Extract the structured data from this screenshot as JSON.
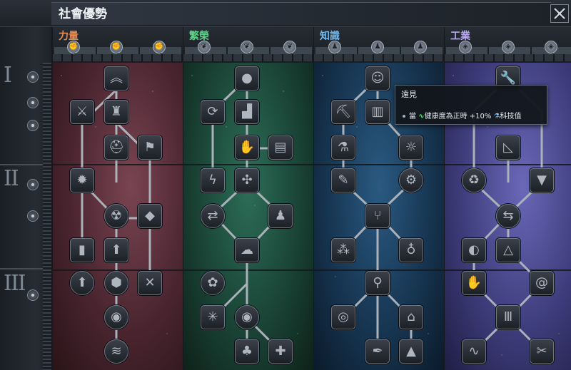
{
  "window": {
    "title": "社會優勢",
    "close_icon": "close-icon"
  },
  "tiers": [
    {
      "label": "I"
    },
    {
      "label": "II"
    },
    {
      "label": "III"
    }
  ],
  "columns": [
    {
      "name": "力量",
      "color": "#e88a4e",
      "sub_icons": [
        "fist-icon",
        "fist-icon",
        "fist-icon"
      ]
    },
    {
      "name": "繁榮",
      "color": "#5fd08a",
      "sub_icons": [
        "leaf-icon",
        "leaf-icon",
        "leaf-icon"
      ]
    },
    {
      "name": "知識",
      "color": "#6fb8ec",
      "sub_icons": [
        "person-icon",
        "person-icon",
        "person-icon"
      ]
    },
    {
      "name": "工業",
      "color": "#b9a8ef",
      "sub_icons": [
        "cube-icon",
        "cube-icon",
        "cube-icon"
      ]
    }
  ],
  "tooltip": {
    "title": "遠見",
    "prefix": "當",
    "condition": "健康度為正時",
    "bonus": "+10%",
    "resource": "科技值"
  }
}
